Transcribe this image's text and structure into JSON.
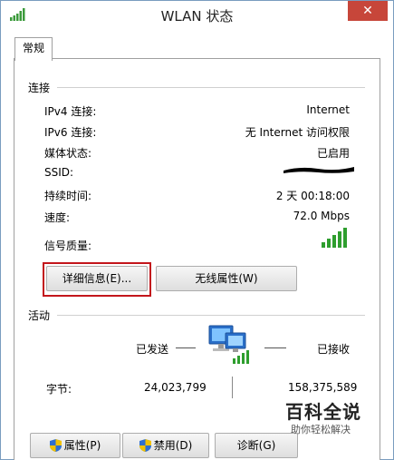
{
  "window": {
    "title": "WLAN 状态",
    "close_label": "✕"
  },
  "tabs": [
    {
      "label": "常规"
    }
  ],
  "connection": {
    "section_title": "连接",
    "rows": [
      {
        "label": "IPv4 连接:",
        "value": "Internet"
      },
      {
        "label": "IPv6 连接:",
        "value": "无 Internet 访问权限"
      },
      {
        "label": "媒体状态:",
        "value": "已启用"
      },
      {
        "label": "SSID:",
        "value": ""
      },
      {
        "label": "持续时间:",
        "value": "2 天 00:18:00"
      },
      {
        "label": "速度:",
        "value": "72.0 Mbps"
      },
      {
        "label": "信号质量:",
        "value": "",
        "signal_bars": 5
      }
    ],
    "details_button": "详细信息(E)...",
    "wireless_props_button": "无线属性(W)"
  },
  "activity": {
    "section_title": "活动",
    "sent_label": "已发送",
    "received_label": "已接收",
    "bytes_label": "字节:",
    "bytes_sent": "24,023,799",
    "bytes_received": "158,375,589"
  },
  "footer_buttons": {
    "properties": "属性(P)",
    "disable": "禁用(D)",
    "diagnose": "诊断(G)"
  },
  "watermark": {
    "main": "百科全说",
    "sub": "助你轻松解决"
  },
  "colors": {
    "highlight_border": "#c3161c",
    "signal_green": "#2e9e2e",
    "close_button": "#c7463a"
  },
  "icons": {
    "title": "wifi-signal-icon",
    "network": "network-computers-icon",
    "shield": "uac-shield-icon"
  }
}
